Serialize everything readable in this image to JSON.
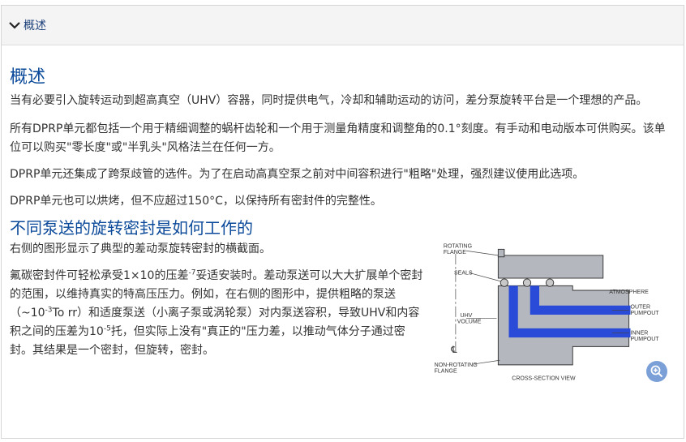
{
  "accordion": {
    "title": "概述"
  },
  "overview": {
    "heading": "概述",
    "p1": "当有必要引入旋转运动到超高真空（UHV）容器，同时提供电气，冷却和辅助运动的访问，差分泵旋转平台是一个理想的产品。",
    "p2": "所有DPRP单元都包括一个用于精细调整的蜗杆齿轮和一个用于测量角精度和调整角的0.1°刻度。有手动和电动版本可供购买。该单位可以购买\"零长度\"或\"半乳头\"风格法兰在任何一方。",
    "p3": "DPRP单元还集成了跨泵歧管的选件。为了在启动高真空泵之前对中间容积进行\"粗略\"处理，强烈建议使用此选项。",
    "p4": "DPRP单元也可以烘烤，但不应超过150°C，以保持所有密封件的完整性。"
  },
  "how": {
    "heading": "不同泵送的旋转密封是如何工作的",
    "p1": "右侧的图形显示了典型的差动泵旋转密封的横截面。",
    "p2_a": "氟碳密封件可轻松承受1×10的压差",
    "p2_sup1": "-7",
    "p2_b": "妥适安装时。差动泵送可以大大扩展单个密封的范围，以维持真实的特高压压力。例如，在右侧的图形中，提供粗略的泵送（~10",
    "p2_sup2": "-3",
    "p2_c": "To rr）和适度泵送（小离子泵或涡轮泵）对内泵送容积，导致UHV和内容积之间的压差为10",
    "p2_sup3": "-5",
    "p2_d": "托，但实际上没有\"真正的\"压力差，以推动气体分子通过密封。其结果是一个密封，但旋转，密封。"
  },
  "figure": {
    "labels": {
      "rotating_flange_1": "ROTATING",
      "rotating_flange_2": "FLANGE",
      "seals": "SEALS",
      "atmosphere": "ATMOSPHERE",
      "outer_pumpout_1": "OUTER",
      "outer_pumpout_2": "PUMPOUT",
      "uhv_volume_1": "UHV",
      "uhv_volume_2": "VOLUME",
      "inner_pumpout_1": "INNER",
      "inner_pumpout_2": "PUMPOUT",
      "non_rotating_1": "NON-ROTATING",
      "non_rotating_2": "FLANGE",
      "cross_section": "CROSS-SECTION VIEW",
      "centerline": "℄"
    },
    "colors": {
      "metal": "#b4b7bd",
      "channel": "#2a4bd8",
      "outline": "#333333"
    }
  },
  "zoom": {
    "icon": "zoom-in-icon"
  }
}
